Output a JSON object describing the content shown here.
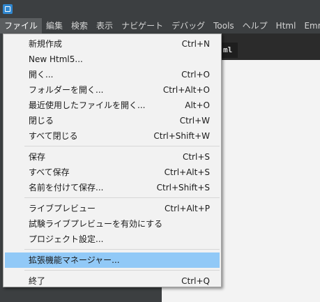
{
  "menubar": {
    "items": [
      {
        "label": "ファイル",
        "active": true
      },
      {
        "label": "編集"
      },
      {
        "label": "検索"
      },
      {
        "label": "表示"
      },
      {
        "label": "ナビゲート"
      },
      {
        "label": "デバッグ"
      },
      {
        "label": "Tools"
      },
      {
        "label": "ヘルプ"
      },
      {
        "label": "Html"
      },
      {
        "label": "Emmet"
      }
    ]
  },
  "editor": {
    "tab_label": "ml"
  },
  "file_menu": {
    "items": [
      {
        "label": "新規作成",
        "shortcut": "Ctrl+N"
      },
      {
        "label": "New Html5...",
        "shortcut": ""
      },
      {
        "label": "開く...",
        "shortcut": "Ctrl+O"
      },
      {
        "label": "フォルダーを開く...",
        "shortcut": "Ctrl+Alt+O"
      },
      {
        "label": "最近使用したファイルを開く...",
        "shortcut": "Alt+O"
      },
      {
        "label": "閉じる",
        "shortcut": "Ctrl+W"
      },
      {
        "label": "すべて閉じる",
        "shortcut": "Ctrl+Shift+W"
      },
      {
        "label": "保存",
        "shortcut": "Ctrl+S"
      },
      {
        "label": "すべて保存",
        "shortcut": "Ctrl+Alt+S"
      },
      {
        "label": "名前を付けて保存...",
        "shortcut": "Ctrl+Shift+S"
      },
      {
        "label": "ライブプレビュー",
        "shortcut": "Ctrl+Alt+P"
      },
      {
        "label": "試験ライブプレビューを有効にする",
        "shortcut": ""
      },
      {
        "label": "プロジェクト設定...",
        "shortcut": ""
      },
      {
        "label": "拡張機能マネージャー...",
        "shortcut": "",
        "highlighted": true
      },
      {
        "label": "終了",
        "shortcut": "Ctrl+Q"
      }
    ]
  },
  "colors": {
    "menu_highlight": "#91c9f7",
    "menubar_bg": "#3c3f41",
    "menu_bg": "#f2f2f2",
    "app_icon": "#2f86ce"
  }
}
